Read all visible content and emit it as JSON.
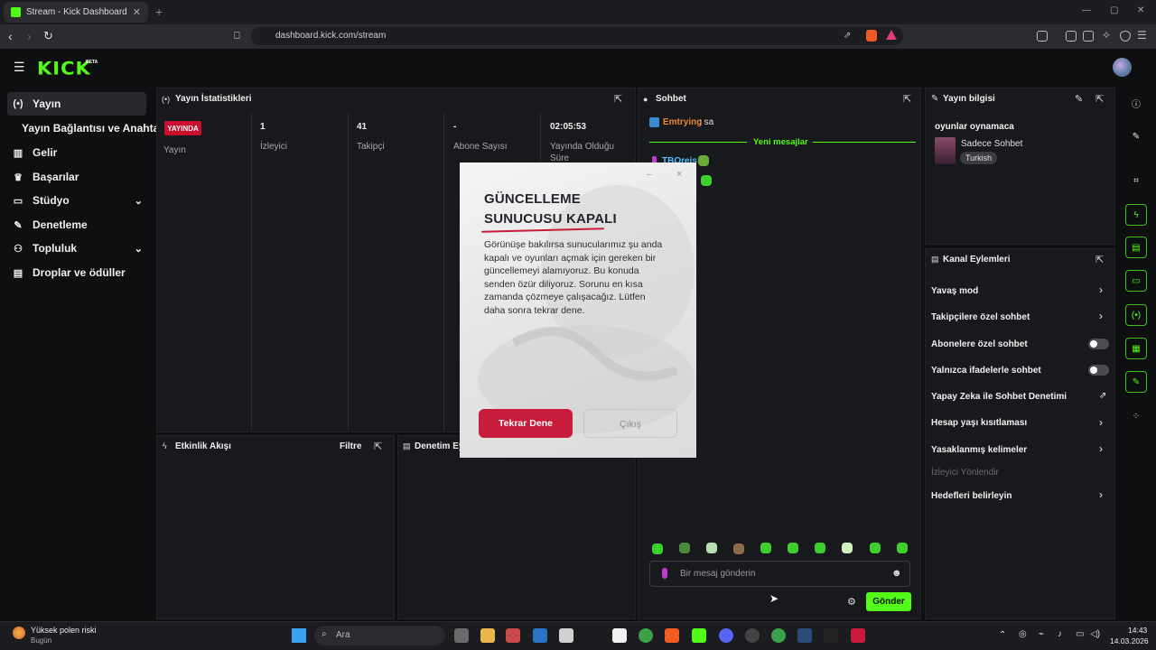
{
  "browser": {
    "tab_title": "Stream - Kick Dashboard",
    "url": "dashboard.kick.com/stream"
  },
  "app": {
    "logo": "KICK",
    "logo_badge": "BETA"
  },
  "sidebar": {
    "items": [
      {
        "label": "Yayın",
        "icon": "broadcast-icon"
      },
      {
        "label": "Yayın Bağlantısı ve Anahtarı"
      },
      {
        "label": "Gelir",
        "icon": "chart-icon"
      },
      {
        "label": "Başarılar",
        "icon": "trophy-icon"
      },
      {
        "label": "Stüdyo",
        "icon": "studio-icon"
      },
      {
        "label": "Denetleme",
        "icon": "wrench-icon"
      },
      {
        "label": "Topluluk",
        "icon": "community-icon"
      },
      {
        "label": "Droplar ve ödüller",
        "icon": "drops-icon"
      }
    ]
  },
  "stats": {
    "title": "Yayın İstatistikleri",
    "live_badge": "YAYINDA",
    "stream_label": "Yayın",
    "viewers_value": "1",
    "viewers_label": "İzleyici",
    "followers_value": "41",
    "followers_label": "Takipçi",
    "subs_value": "-",
    "subs_label": "Abone Sayısı",
    "uptime_value": "02:05:53",
    "uptime_label": "Yayında Olduğu Süre"
  },
  "activity": {
    "title": "Etkinlik Akışı",
    "filter": "Filtre"
  },
  "moderation": {
    "title": "Denetim Ey"
  },
  "chat": {
    "title": "Sohbet",
    "messages": [
      {
        "user": "Emtrying",
        "text": "sa"
      }
    ],
    "new_messages": "Yeni mesajlar",
    "second_user": "TBOreis",
    "input_placeholder": "Bir mesaj gönderin",
    "send": "Gönder"
  },
  "stream_info": {
    "title": "Yayın bilgisi",
    "stream_title": "oyunlar oynamaca",
    "category": "Sadece Sohbet",
    "tag": "Turkish"
  },
  "channel_actions": {
    "title": "Kanal Eylemleri",
    "items": [
      {
        "label": "Yavaş mod",
        "type": "chevron"
      },
      {
        "label": "Takipçilere özel sohbet",
        "type": "chevron"
      },
      {
        "label": "Abonelere özel sohbet",
        "type": "toggle",
        "on": false
      },
      {
        "label": "Yalnızca ifadelerle sohbet",
        "type": "toggle",
        "on": false
      },
      {
        "label": "Yapay Zeka ile Sohbet Denetimi",
        "type": "external"
      },
      {
        "label": "Hesap yaşı kısıtlaması",
        "type": "chevron"
      },
      {
        "label": "Yasaklanmış kelimeler",
        "type": "chevron"
      },
      {
        "label": "İzleyici Yönlendir",
        "type": "disabled"
      },
      {
        "label": "Hedefleri belirleyin",
        "type": "chevron"
      }
    ]
  },
  "modal": {
    "title_line1": "GÜNCELLEME",
    "title_line2": "SUNUCUSU KAPALI",
    "body": "Görünüşe bakılırsa sunucularımız şu anda kapalı ve oyunları açmak için gereken bir güncellemeyi alamıyoruz. Bu konuda senden özür diliyoruz. Sorunu en kısa zamanda çözmeye çalışacağız. Lütfen daha sonra tekrar dene.",
    "retry": "Tekrar Dene",
    "exit": "Çıkış",
    "min": "–",
    "close": "×"
  },
  "taskbar": {
    "weather_title": "Yüksek polen riski",
    "weather_sub": "Bugün",
    "search": "Ara",
    "time": "14:43",
    "date": "14.03.2026"
  },
  "colors": {
    "kick_green": "#53fc18",
    "live_red": "#c8102e",
    "modal_red": "#c81d3a"
  }
}
